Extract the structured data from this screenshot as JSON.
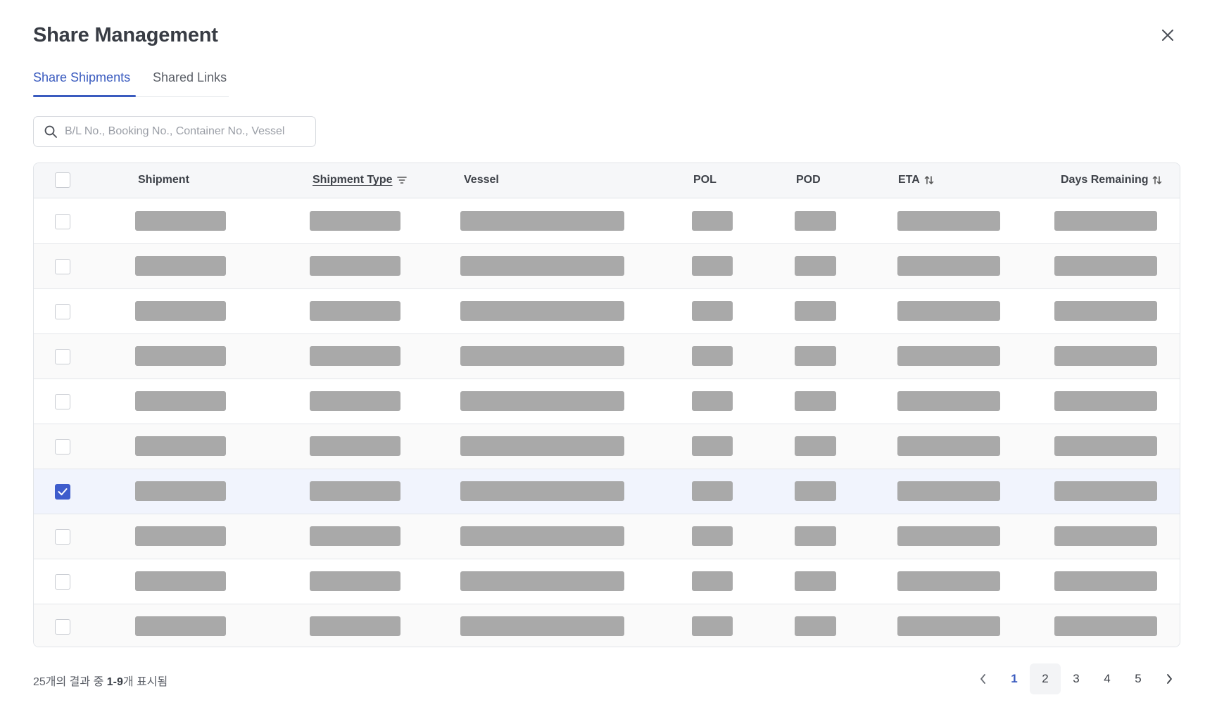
{
  "dialog": {
    "title": "Share Management",
    "close_icon": "close-icon"
  },
  "tabs": [
    {
      "label": "Share Shipments",
      "active": true
    },
    {
      "label": "Shared Links",
      "active": false
    }
  ],
  "search": {
    "placeholder": "B/L No., Booking No., Container No., Vessel",
    "value": "",
    "icon": "search-icon"
  },
  "table": {
    "columns": [
      {
        "key": "shipment",
        "label": "Shipment"
      },
      {
        "key": "shipment_type",
        "label": "Shipment Type",
        "icon": "filter-icon"
      },
      {
        "key": "vessel",
        "label": "Vessel"
      },
      {
        "key": "pol",
        "label": "POL"
      },
      {
        "key": "pod",
        "label": "POD"
      },
      {
        "key": "eta",
        "label": "ETA",
        "icon": "sort-icon"
      },
      {
        "key": "days_remaining",
        "label": "Days Remaining",
        "icon": "sort-icon"
      }
    ],
    "rows": [
      {
        "checked": false
      },
      {
        "checked": false
      },
      {
        "checked": false
      },
      {
        "checked": false
      },
      {
        "checked": false
      },
      {
        "checked": false
      },
      {
        "checked": true
      },
      {
        "checked": false
      },
      {
        "checked": false
      },
      {
        "checked": false
      }
    ],
    "placeholder_color": "#a9a9a9"
  },
  "footer": {
    "count_prefix": "25개의 결과 중 ",
    "count_range": "1-9",
    "count_suffix": "개 표시됨"
  },
  "pagination": {
    "pages": [
      "1",
      "2",
      "3",
      "4",
      "5"
    ],
    "current": "1",
    "prev_icon": "chevron-left-icon",
    "next_icon": "chevron-right-icon"
  },
  "colors": {
    "accent": "#3a5bbf",
    "checkbox_checked": "#3e5ccc",
    "selected_row": "#f1f4fd"
  }
}
